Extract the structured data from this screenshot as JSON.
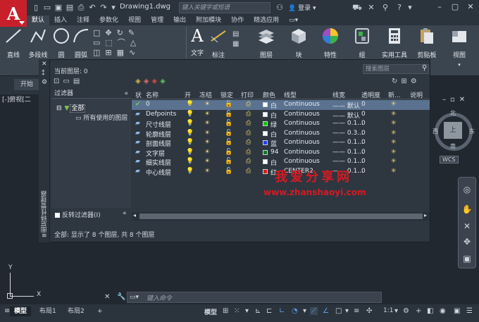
{
  "app": {
    "logo_letter": "A",
    "doc_title": "Drawing1.dwg",
    "search_placeholder": "键入关键字或短语",
    "login": "登录"
  },
  "ribbon_tabs": [
    "默认",
    "插入",
    "注释",
    "参数化",
    "视图",
    "管理",
    "输出",
    "附加模块",
    "协作",
    "精选应用"
  ],
  "ribbon_tools": {
    "line": "直线",
    "polyline": "多段线",
    "circle": "圆",
    "arc": "圆弧",
    "text": "文字",
    "dimension": "标注",
    "layer": "图层",
    "block": "块",
    "properties": "特性",
    "group": "组",
    "utilities": "实用工具",
    "clipboard": "剪贴板",
    "view": "视图"
  },
  "start_tab": "开始",
  "viewport_label": "[-]俯视[二",
  "layer_manager": {
    "current_layer": "当前图层: 0",
    "search_placeholder": "搜索图层",
    "filter_header": "过滤器",
    "tree_all": "全部",
    "tree_used": "所有使用的图层",
    "invert_filter": "反转过滤器(I)",
    "vertical_title": "图层特性管理器",
    "status": "全部: 显示了 8 个图层, 共 8 个图层",
    "columns": [
      "状",
      "名称",
      "开",
      "冻结",
      "锁定",
      "打印",
      "颜色",
      "线型",
      "线宽",
      "透明度",
      "新...",
      "说明"
    ],
    "rows": [
      {
        "name": "0",
        "color_name": "白",
        "color": "#ffffff",
        "linetype": "Continuous",
        "lineweight": "默认",
        "transparency": "0",
        "selected": true,
        "current": true
      },
      {
        "name": "Defpoints",
        "color_name": "白",
        "color": "#ffffff",
        "linetype": "Continuous",
        "lineweight": "默认",
        "transparency": "0"
      },
      {
        "name": "尺寸线层",
        "color_name": "绿",
        "color": "#00c800",
        "linetype": "Continuous",
        "lineweight": "0.1...",
        "transparency": "0"
      },
      {
        "name": "轮廓线层",
        "color_name": "白",
        "color": "#ffffff",
        "linetype": "Continuous",
        "lineweight": "0.3...",
        "transparency": "0"
      },
      {
        "name": "剖面线层",
        "color_name": "蓝",
        "color": "#1e3cff",
        "linetype": "Continuous",
        "lineweight": "0.1...",
        "transparency": "0"
      },
      {
        "name": "文字层",
        "color_name": "94",
        "color": "#0b7a23",
        "linetype": "Continuous",
        "lineweight": "0.1...",
        "transparency": "0"
      },
      {
        "name": "细实线层",
        "color_name": "白",
        "color": "#ffffff",
        "linetype": "Continuous",
        "lineweight": "0.1...",
        "transparency": "0"
      },
      {
        "name": "中心线层",
        "color_name": "红",
        "color": "#e01818",
        "linetype": "CENTER2",
        "lineweight": "0.1...",
        "transparency": "0"
      }
    ]
  },
  "watermark": {
    "line1": "我爱分享网",
    "line2": "www.zhanshaoyi.com"
  },
  "viewcube": {
    "top": "上",
    "north": "北",
    "south": "南",
    "west": "西",
    "east": "东",
    "wcs": "WCS"
  },
  "ucs": {
    "y": "Y",
    "x": "X"
  },
  "command": {
    "placeholder": "键入命令"
  },
  "layout_tabs": [
    "模型",
    "布局1",
    "布局2"
  ],
  "status_bar": {
    "model": "模型",
    "scale": "1:1"
  }
}
